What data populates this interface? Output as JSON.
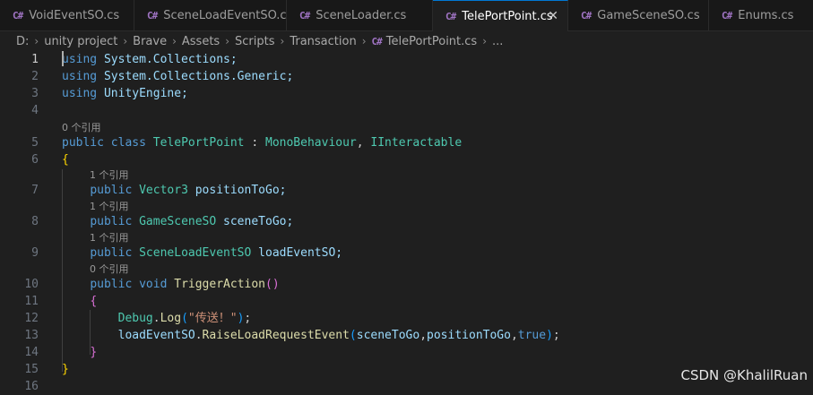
{
  "tabs": [
    {
      "label": "VoidEventSO.cs",
      "icon": "csharp-icon"
    },
    {
      "label": "SceneLoadEventSO.cs",
      "icon": "csharp-icon"
    },
    {
      "label": "SceneLoader.cs",
      "icon": "csharp-icon"
    },
    {
      "label": "TelePortPoint.cs",
      "icon": "csharp-icon",
      "active": true
    },
    {
      "label": "GameSceneSO.cs",
      "icon": "csharp-icon"
    },
    {
      "label": "Enums.cs",
      "icon": "csharp-icon"
    }
  ],
  "breadcrumb": [
    "D:",
    "unity project",
    "Brave",
    "Assets",
    "Scripts",
    "Transaction",
    "TelePortPoint.cs",
    "..."
  ],
  "editor": {
    "line_numbers": [
      "1",
      "2",
      "3",
      "4",
      "5",
      "6",
      "7",
      "8",
      "9",
      "10",
      "11",
      "12",
      "13",
      "14",
      "15",
      "16"
    ],
    "codelens": {
      "class": "0 个引用",
      "positionToGo": "1 个引用",
      "sceneToGo": "1 个引用",
      "loadEventSO": "1 个引用",
      "TriggerAction": "0 个引用"
    },
    "tokens": {
      "using": "using",
      "ns1": "System.Collections;",
      "ns2": "System.Collections.Generic;",
      "ns3": "UnityEngine;",
      "public": "public",
      "class": "class",
      "void": "void",
      "class_name": "TelePortPoint",
      "colon": " : ",
      "base1": "MonoBehaviour",
      "comma": ", ",
      "base2": "IInteractable",
      "t_vector3": "Vector3",
      "f_position": "positionToGo;",
      "t_gamescene": "GameSceneSO",
      "f_scene": "sceneToGo;",
      "t_sceneload": "SceneLoadEventSO",
      "f_load": "loadEventSO;",
      "m_trigger": "TriggerAction",
      "brace_open": "{",
      "brace_close": "}",
      "paren_pair": "()",
      "debug": "Debug",
      "dot": ".",
      "log": "Log",
      "paren_open": "(",
      "str": "\"传送！\"",
      "paren_close_semi": ");",
      "load_obj": "loadEventSO",
      "raise": "RaiseLoadRequestEvent",
      "arg_scene": "sceneToGo",
      "arg_comma": ",",
      "arg_pos": "positionToGo",
      "true": "true",
      "close_paren": ")",
      "semi": ";"
    }
  },
  "watermark": "CSDN @KhalilRuan",
  "colors": {
    "keyword": "#569cd6",
    "type": "#4ec9b0",
    "identifier": "#9cdcfe",
    "function": "#dcdcaa",
    "string": "#ce9178",
    "active_tab_border": "#0078d4"
  }
}
